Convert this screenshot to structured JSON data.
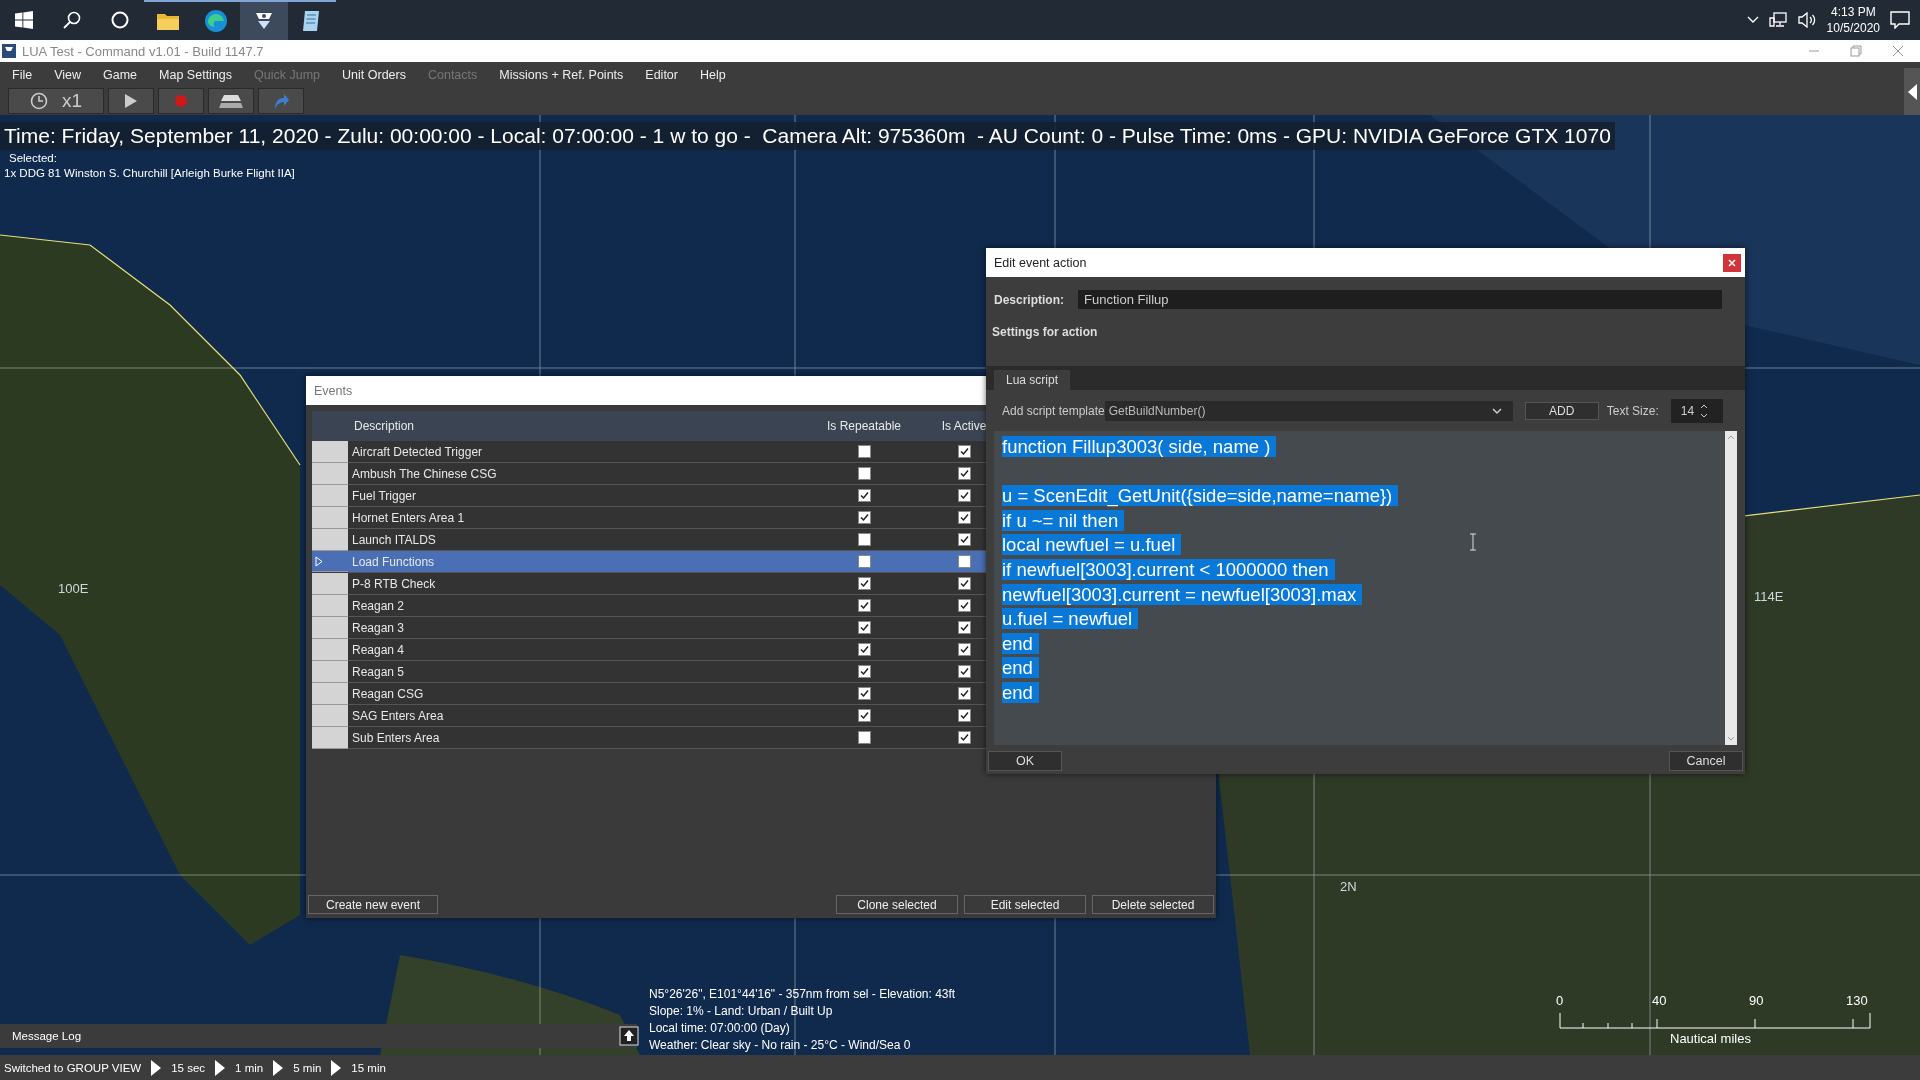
{
  "taskbar": {
    "apps": [
      {
        "kind": "folder",
        "selected": false
      },
      {
        "kind": "browser",
        "selected": false
      },
      {
        "kind": "game",
        "selected": true
      },
      {
        "kind": "notes",
        "selected": false
      }
    ],
    "time": "4:13 PM",
    "date": "10/5/2020"
  },
  "window": {
    "title": "LUA Test - Command v1.01 - Build 1147.7"
  },
  "menu": [
    {
      "label": "File",
      "disabled": false
    },
    {
      "label": "View",
      "disabled": false
    },
    {
      "label": "Game",
      "disabled": false
    },
    {
      "label": "Map Settings",
      "disabled": false
    },
    {
      "label": "Quick Jump",
      "disabled": true
    },
    {
      "label": "Unit Orders",
      "disabled": false
    },
    {
      "label": "Contacts",
      "disabled": true
    },
    {
      "label": "Missions + Ref. Points",
      "disabled": false
    },
    {
      "label": "Editor",
      "disabled": false
    },
    {
      "label": "Help",
      "disabled": false
    }
  ],
  "toolbar": {
    "speed": "x1"
  },
  "hud": {
    "status": "Time: Friday, September 11, 2020 - Zulu: 00:00:00 - Local: 07:00:00 - 1 w to go -  Camera Alt: 975360m  - AU Count: 0 - Pulse Time: 0ms - GPU: NVIDIA GeForce GTX 1070",
    "selected_label": "Selected:",
    "selected_unit": "1x DDG 81 Winston S. Churchill [Arleigh Burke Flight IIA]"
  },
  "map_labels": [
    "100E",
    "114E",
    "2N"
  ],
  "events": {
    "title": "Events",
    "columns": [
      "Description",
      "Is Repeatable",
      "Is Active"
    ],
    "rows": [
      {
        "description": "Aircraft Detected Trigger",
        "repeatable": false,
        "active": true,
        "selected": false
      },
      {
        "description": "Ambush The Chinese CSG",
        "repeatable": false,
        "active": true,
        "selected": false
      },
      {
        "description": "Fuel Trigger",
        "repeatable": true,
        "active": true,
        "selected": false
      },
      {
        "description": "Hornet Enters Area 1",
        "repeatable": true,
        "active": true,
        "selected": false
      },
      {
        "description": "Launch ITALDS",
        "repeatable": false,
        "active": true,
        "selected": false
      },
      {
        "description": "Load Functions",
        "repeatable": false,
        "active": false,
        "selected": true
      },
      {
        "description": "P-8 RTB Check",
        "repeatable": true,
        "active": true,
        "selected": false
      },
      {
        "description": "Reagan 2",
        "repeatable": true,
        "active": true,
        "selected": false
      },
      {
        "description": "Reagan 3",
        "repeatable": true,
        "active": true,
        "selected": false
      },
      {
        "description": "Reagan 4",
        "repeatable": true,
        "active": true,
        "selected": false
      },
      {
        "description": "Reagan 5",
        "repeatable": true,
        "active": true,
        "selected": false
      },
      {
        "description": "Reagan CSG",
        "repeatable": true,
        "active": true,
        "selected": false
      },
      {
        "description": "SAG Enters Area",
        "repeatable": true,
        "active": true,
        "selected": false
      },
      {
        "description": "Sub Enters Area",
        "repeatable": false,
        "active": true,
        "selected": false
      }
    ],
    "left_button": "Create new event",
    "right_buttons": [
      "Clone selected",
      "Edit selected",
      "Delete selected"
    ]
  },
  "edit": {
    "title": "Edit event action",
    "description_label": "Description:",
    "description": "Function Fillup",
    "settings_label": "Settings for action",
    "tab": "Lua script",
    "template_label": "Add script template",
    "template": "GetBuildNumber()",
    "add": "ADD",
    "text_size_label": "Text Size:",
    "text_size": "14",
    "code_selected": true,
    "code_blocks": [
      [
        "function Fillup3003( side, name )"
      ],
      [
        "u = ScenEdit_GetUnit({side=side,name=name})",
        "if u ~= nil then",
        "local newfuel = u.fuel",
        "if newfuel[3003].current < 1000000 then",
        "newfuel[3003].current = newfuel[3003].max",
        "u.fuel = newfuel",
        "end",
        "end",
        "end"
      ]
    ],
    "ok": "OK",
    "cancel": "Cancel"
  },
  "cursor_info": [
    "N5°26'26\", E101°44'16\" - 357nm from sel - Elevation: 43ft",
    "Slope: 1%  - Land: Urban / Built Up",
    "Local time: 07:00:00 (Day)",
    "Weather: Clear sky - No rain - 25°C - Wind/Sea 0"
  ],
  "scale": {
    "ticks": [
      "0",
      "40",
      "90",
      "130"
    ],
    "unit": "Nautical miles"
  },
  "message_log": {
    "title": "Message Log"
  },
  "status_bar": {
    "text": "Switched to GROUP VIEW",
    "steps": [
      "15 sec",
      "1 min",
      "5 min",
      "15 min"
    ]
  }
}
